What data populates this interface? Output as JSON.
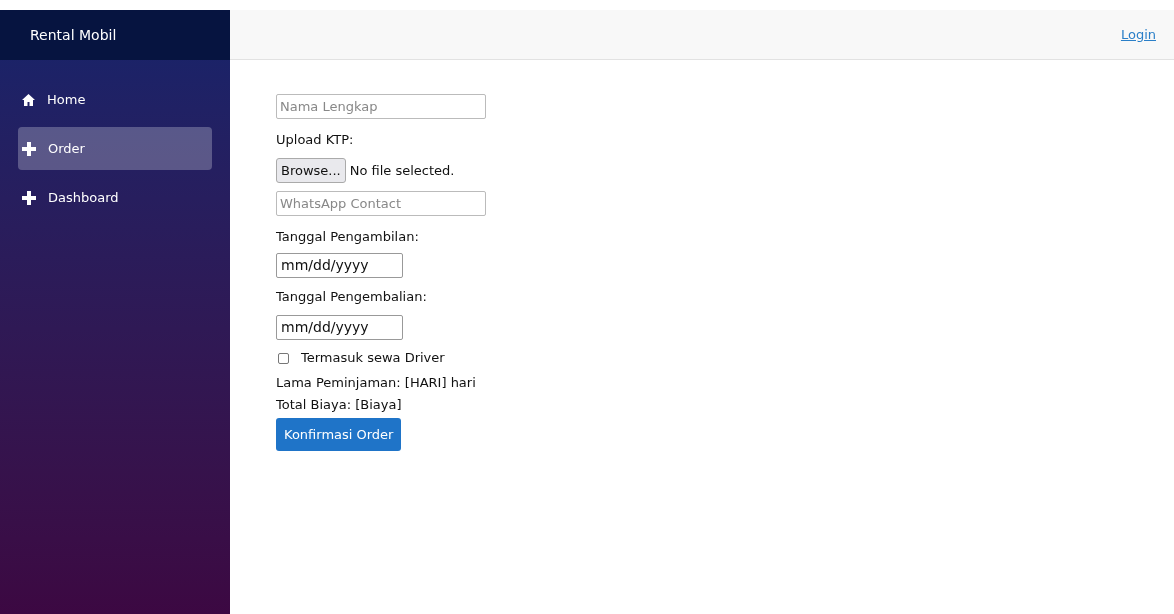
{
  "sidebar": {
    "title": "Rental Mobil",
    "items": [
      {
        "label": "Home",
        "kind": "home",
        "selected": false
      },
      {
        "label": "Order",
        "kind": "plus",
        "selected": true
      },
      {
        "label": "Dashboard",
        "kind": "plus",
        "selected": false
      }
    ]
  },
  "header": {
    "login_link": "Login"
  },
  "form": {
    "name_field": {
      "placeholder": "Nama Lengkap"
    },
    "upload_label": "Upload KTP:",
    "browse_button": "Browse...",
    "file_status": "No file selected.",
    "whatsapp_field": {
      "placeholder": "WhatsApp Contact"
    },
    "pickup_label": "Tanggal Pengambilan:",
    "pickup_date": "mm/dd/yyyy",
    "return_label": "Tanggal Pengembalian:",
    "return_date": "mm/dd/yyyy",
    "driver_checkbox": {
      "label": "Termasuk sewa Driver",
      "checked": false
    },
    "duration_text": "Lama Peminjaman: [HARI] hari",
    "total_text": "Total Biaya: [Biaya]",
    "submit_button": "Konfirmasi Order"
  }
}
